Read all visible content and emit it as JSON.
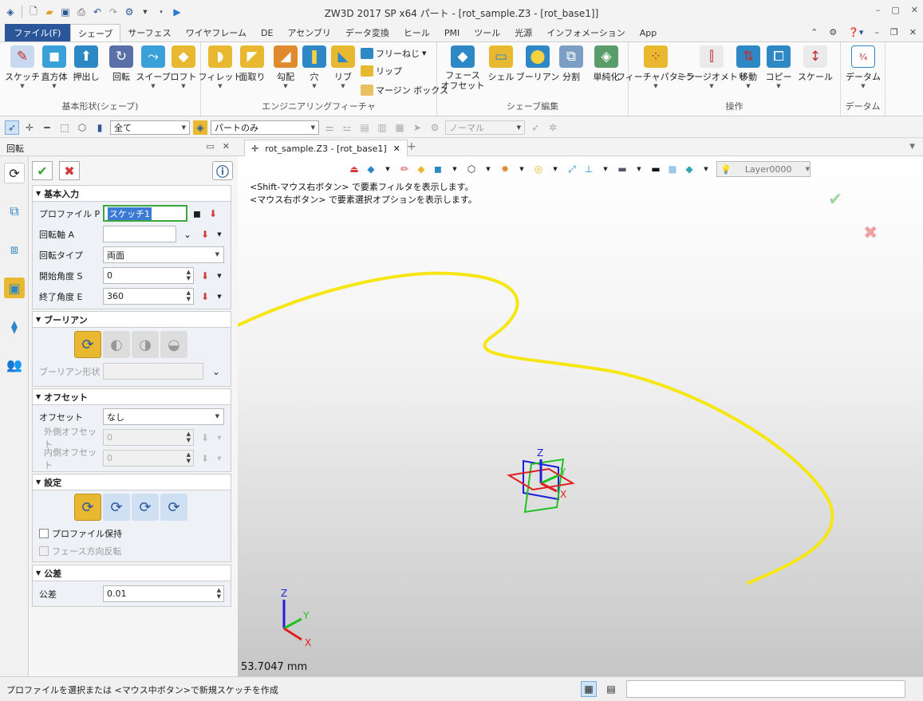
{
  "titlebar": {
    "title": "ZW3D 2017 SP x64      パート - [rot_sample.Z3 - [rot_base1]]"
  },
  "menu_tabs": [
    "ファイル(F)",
    "シェーブ",
    "サーフェス",
    "ワイヤフレーム",
    "DE",
    "アセンブリ",
    "データ変換",
    "ヒール",
    "PMI",
    "ツール",
    "光源",
    "インフォメーション",
    "App"
  ],
  "ribbon": {
    "groups": [
      {
        "label": "基本形状(シェーブ)",
        "buttons": [
          "スケッチ",
          "直方体",
          "押出し",
          "回転",
          "スイープ",
          "ロフト"
        ]
      },
      {
        "label": "エンジニアリングフィーチャ",
        "buttons": [
          "フィレット",
          "面取り",
          "勾配",
          "穴",
          "リブ"
        ],
        "small": [
          "フリーねじ",
          "リップ",
          "マージン ボックス"
        ]
      },
      {
        "label": "シェーブ編集",
        "buttons": [
          "フェース\nオフセット",
          "シェル",
          "ブーリアン",
          "分割",
          "単純化"
        ]
      },
      {
        "label": "操作",
        "buttons": [
          "フィーチャパターン",
          "ミラージオメトリ",
          "移動",
          "コピー",
          "スケール"
        ]
      },
      {
        "label": "データム",
        "buttons": [
          "データム"
        ]
      }
    ]
  },
  "toolbar2": {
    "filter": "全て",
    "scope": "パートのみ",
    "view": "ノーマル"
  },
  "panel": {
    "title": "回転",
    "sections": {
      "basic": {
        "title": "基本入力",
        "profile_label": "プロファイル P",
        "profile_value": "スケッチ1",
        "axis_label": "回転軸 A",
        "axis_value": "",
        "type_label": "回転タイプ",
        "type_value": "両面",
        "start_label": "開始角度 S",
        "start_value": "0",
        "end_label": "終了角度 E",
        "end_value": "360"
      },
      "boolean": {
        "title": "ブーリアン",
        "shape_label": "ブーリアン形状",
        "shape_value": ""
      },
      "offset": {
        "title": "オフセット",
        "offset_label": "オフセット",
        "offset_value": "なし",
        "outer_label": "外側オフセット",
        "outer_value": "0",
        "inner_label": "内側オフセット",
        "inner_value": "0"
      },
      "settings": {
        "title": "設定",
        "keep_profile": "プロファイル保持",
        "reverse_face": "フェース方向反転"
      },
      "tolerance": {
        "title": "公差",
        "tol_label": "公差",
        "tol_value": "0.01"
      }
    }
  },
  "viewport": {
    "tab_title": "rot_sample.Z3 - [rot_base1]",
    "hint1": "<Shift-マウス右ボタン> で要素フィルタを表示します。",
    "hint2": "<マウス右ボタン> で要素選択オプションを表示します。",
    "layer": "Layer0000",
    "distance": "53.7047 mm",
    "axis_labels": {
      "x": "X",
      "y": "Y",
      "z": "Z"
    }
  },
  "status": {
    "message": "プロファイルを選択または <マウス中ボタン>で新規スケッチを作成"
  },
  "colors": {
    "accent": "#2b579a",
    "curve": "#f5e614",
    "ok": "#3aa83a",
    "cancel": "#d33b3b"
  }
}
